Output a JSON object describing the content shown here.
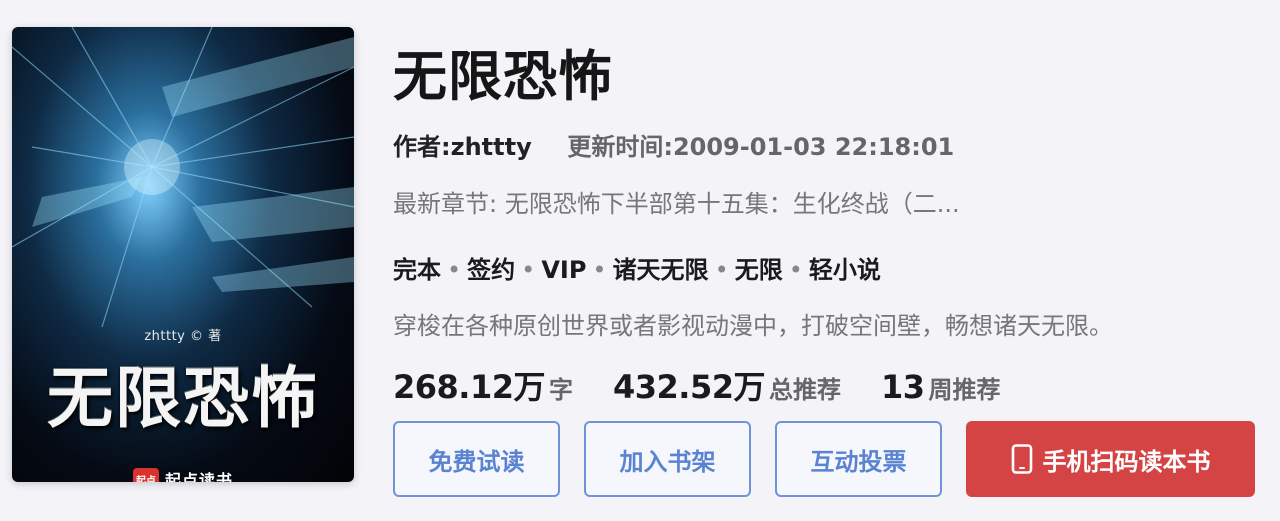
{
  "cover": {
    "author_line": "zhttty © 著",
    "title": "无限恐怖",
    "brand_logo_text": "起点",
    "brand_name": "起点读书"
  },
  "book": {
    "title": "无限恐怖",
    "author": "作者:zhttty",
    "update_time": "更新时间:2009-01-03 22:18:01",
    "latest_chapter": "最新章节: 无限恐怖下半部第十五集：生化终战（二...",
    "tags": [
      "完本",
      "签约",
      "VIP",
      "诸天无限",
      "无限",
      "轻小说"
    ],
    "intro": "穿梭在各种原创世界或者影视动漫中，打破空间壁，畅想诸天无限。",
    "stats": [
      {
        "value": "268.12万",
        "unit": "字"
      },
      {
        "value": "432.52万",
        "unit": "总推荐"
      },
      {
        "value": "13",
        "unit": "周推荐"
      }
    ]
  },
  "actions": {
    "free_read": "免费试读",
    "add_shelf": "加入书架",
    "vote": "互动投票",
    "mobile_read": "手机扫码读本书"
  },
  "colors": {
    "accent_blue": "#5a83d2",
    "primary_red": "#d44444",
    "background": "#f3f3f8"
  }
}
